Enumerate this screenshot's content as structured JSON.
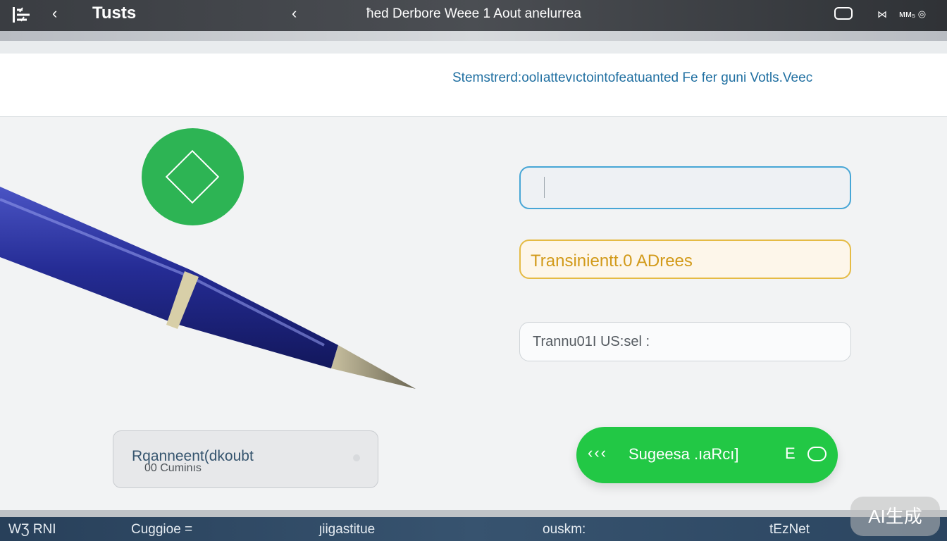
{
  "topbar": {
    "app_title": "Tusts",
    "window_title": "ћed Derbore Weee 1 Aout anelurrea",
    "status_text": "ᴍᴍ₅ ◎"
  },
  "header": {
    "subtitle": "Stemstrerd:oolıattevıctointofeatuanted Fe fer  guni Votls.Veec"
  },
  "form": {
    "field_1_value": "",
    "field_2_value": "Transinientt.0 ADrees",
    "field_3_value": "Trannu01I US:sel :"
  },
  "buttons": {
    "secondary_label_1": "Rqanneent(dkoubt",
    "secondary_label_2": "00 Cuminıs",
    "primary_chevrons": "‹‹‹",
    "primary_label": "Sugeesa .ıaRcı]",
    "primary_icon_text": "E"
  },
  "bottom_nav": {
    "items": [
      "WƷ RNI",
      "Cuggioe =",
      "ȷiigastitue",
      "ouskm:",
      "tEzNet"
    ]
  },
  "watermark": "AI生成",
  "colors": {
    "accent_green": "#22c845",
    "badge_green": "#2db454",
    "field_blue": "#47a6d6",
    "field_amber": "#e5bb45",
    "subtitle_blue": "#1f6fa1",
    "nav_navy": "#2f4a66"
  },
  "icons": {
    "menu": "menu-icon",
    "back": "chevron-left-icon",
    "window": "window-icon",
    "mute": "mute-icon",
    "badge": "diamond-icon",
    "toggle": "toggle-icon"
  }
}
